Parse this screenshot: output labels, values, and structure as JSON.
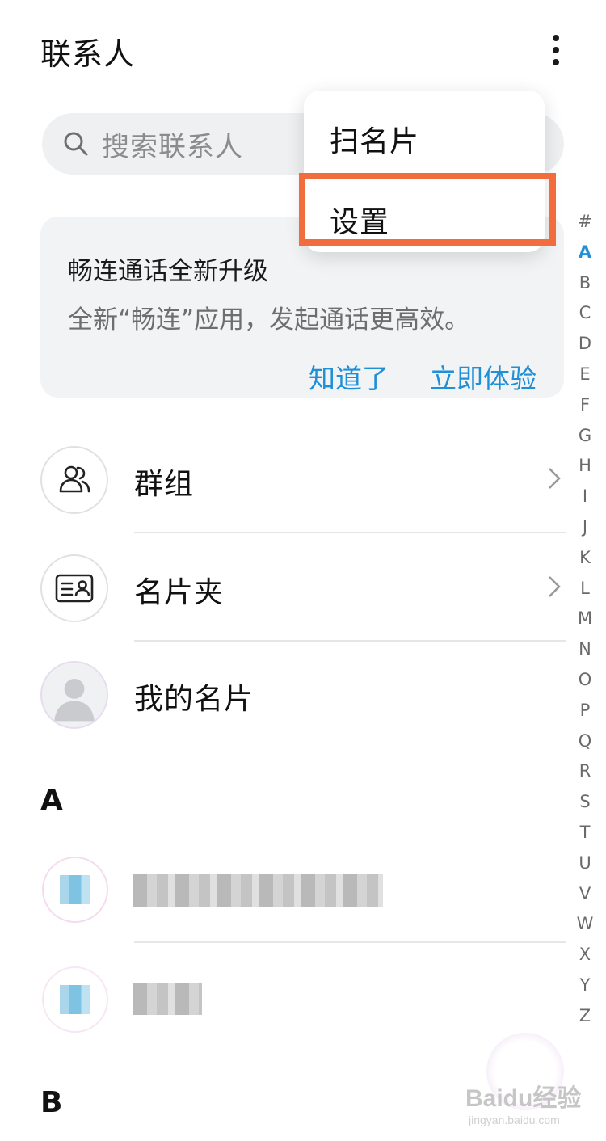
{
  "header": {
    "title": "联系人"
  },
  "search": {
    "placeholder": "搜索联系人"
  },
  "menu": {
    "items": [
      {
        "label": "扫名片"
      },
      {
        "label": "设置"
      }
    ]
  },
  "banner": {
    "title": "畅连通话全新升级",
    "description": "全新“畅连”应用，发起通话更高效。",
    "dismiss_label": "知道了",
    "try_label": "立即体验"
  },
  "rows": [
    {
      "label": "群组",
      "icon": "group-icon"
    },
    {
      "label": "名片夹",
      "icon": "business-card-icon"
    },
    {
      "label": "我的名片",
      "icon": "avatar-icon"
    }
  ],
  "sections": [
    {
      "letter": "A",
      "contacts": [
        {
          "name": ""
        },
        {
          "name": ""
        }
      ]
    },
    {
      "letter": "B"
    }
  ],
  "index_letters": [
    "#",
    "A",
    "B",
    "C",
    "D",
    "E",
    "F",
    "G",
    "H",
    "I",
    "J",
    "K",
    "L",
    "M",
    "N",
    "O",
    "P",
    "Q",
    "R",
    "S",
    "T",
    "U",
    "V",
    "W",
    "X",
    "Y",
    "Z"
  ],
  "index_active": "A",
  "watermark": {
    "text": "Baidu经验",
    "sub": "jingyan.baidu.com"
  },
  "colors": {
    "accent": "#1f8fd6",
    "highlight": "#f16d3d",
    "banner_bg": "#f1f3f5"
  }
}
